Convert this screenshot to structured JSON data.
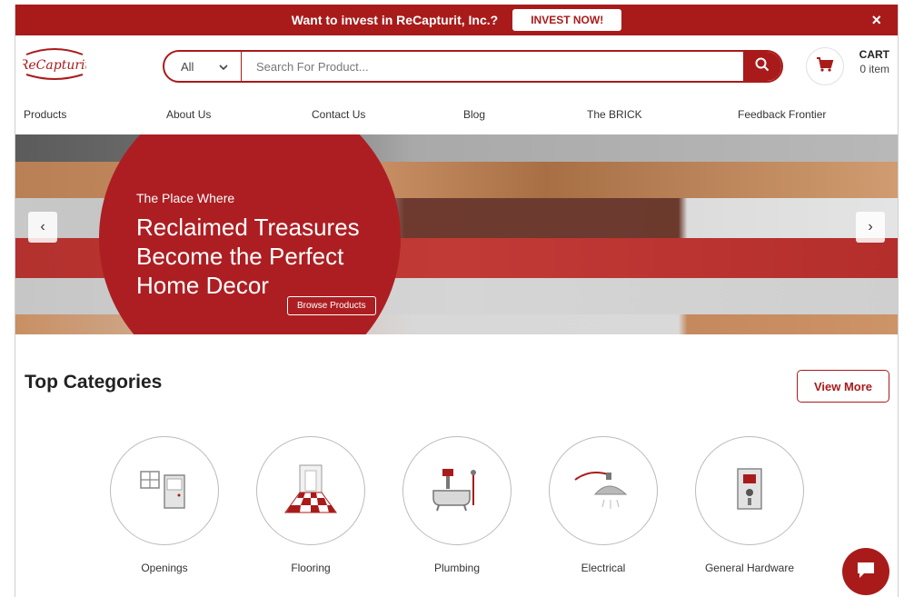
{
  "promo": {
    "text": "Want to invest in ReCapturit, Inc.?",
    "button": "INVEST NOW!",
    "close": "×"
  },
  "header": {
    "logo_text": "ReCapturit",
    "search": {
      "category": "All",
      "placeholder": "Search For Product..."
    },
    "cart": {
      "label": "CART",
      "count": "0 item"
    }
  },
  "nav": [
    "Products",
    "About Us",
    "Contact Us",
    "Blog",
    "The BRICK",
    "Feedback Frontier"
  ],
  "hero": {
    "subtitle": "The Place Where",
    "title": "Reclaimed Treasures Become the Perfect Home Decor",
    "button": "Browse Products",
    "prev": "‹",
    "next": "›"
  },
  "categories": {
    "title": "Top Categories",
    "view_more": "View More",
    "items": [
      {
        "label": "Openings",
        "icon": "door-window-icon"
      },
      {
        "label": "Flooring",
        "icon": "checkered-floor-icon"
      },
      {
        "label": "Plumbing",
        "icon": "bathtub-icon"
      },
      {
        "label": "Electrical",
        "icon": "pendant-lamp-icon"
      },
      {
        "label": "General Hardware",
        "icon": "switch-plate-icon"
      }
    ]
  },
  "colors": {
    "brand_red": "#a91b1b"
  }
}
